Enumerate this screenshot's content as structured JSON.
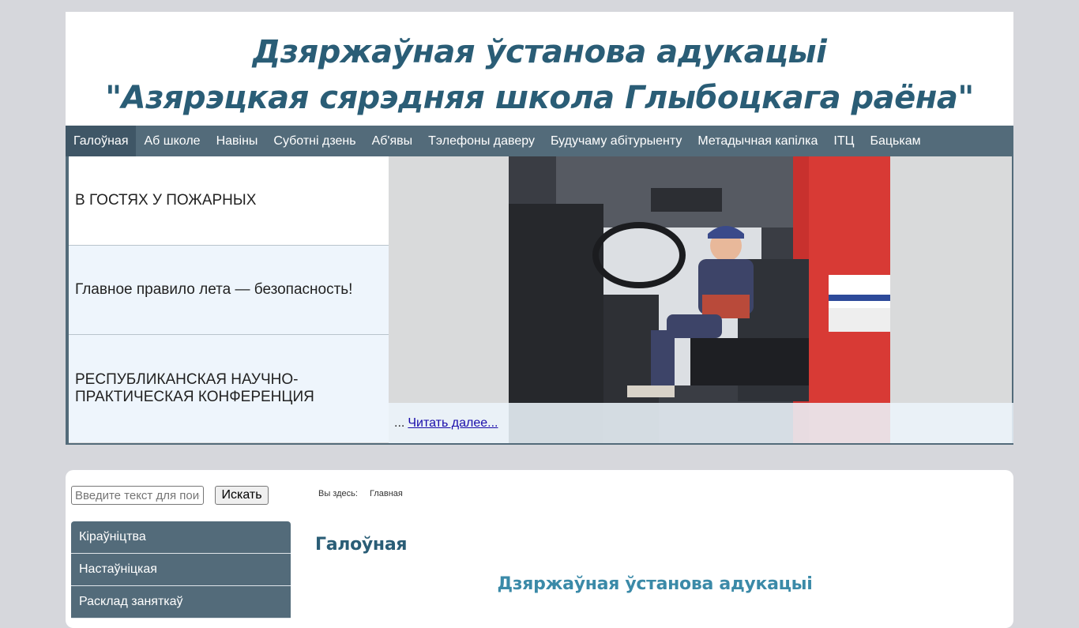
{
  "header": {
    "title_line1": "Дзяржаўная ўстанова адукацыі",
    "title_line2": "\"Азярэцкая сярэдняя школа Глыбоцкага раёна\""
  },
  "nav": {
    "items": [
      {
        "label": "Галоўная"
      },
      {
        "label": "Аб школе"
      },
      {
        "label": "Навіны"
      },
      {
        "label": "Суботні дзень"
      },
      {
        "label": "Аб'явы"
      },
      {
        "label": "Тэлефоны даверу"
      },
      {
        "label": "Будучаму абітурыенту"
      },
      {
        "label": "Метадычная капілка"
      },
      {
        "label": "ІТЦ"
      },
      {
        "label": "Бацькам"
      }
    ]
  },
  "slider": {
    "items": [
      {
        "label": "В ГОСТЯХ У ПОЖАРНЫХ"
      },
      {
        "label": "Главное правило лета — безопасность!"
      },
      {
        "label": "РЕСПУБЛИКАНСКАЯ НАУЧНО-ПРАКТИЧЕСКАЯ КОНФЕРЕНЦИЯ"
      }
    ],
    "ellipsis": "...",
    "read_more": "Читать далее..."
  },
  "search": {
    "placeholder": "Введите текст для поиска...",
    "button": "Искать"
  },
  "side_menu": {
    "items": [
      {
        "label": "Кіраўніцтва"
      },
      {
        "label": "Настаўніцкая"
      },
      {
        "label": "Расклад заняткаў"
      }
    ]
  },
  "breadcrumb": {
    "prefix": "Вы здесь:",
    "current": "Главная"
  },
  "main": {
    "page_heading": "Галоўная",
    "article_title": "Дзяржаўная ўстанова адукацыі"
  }
}
